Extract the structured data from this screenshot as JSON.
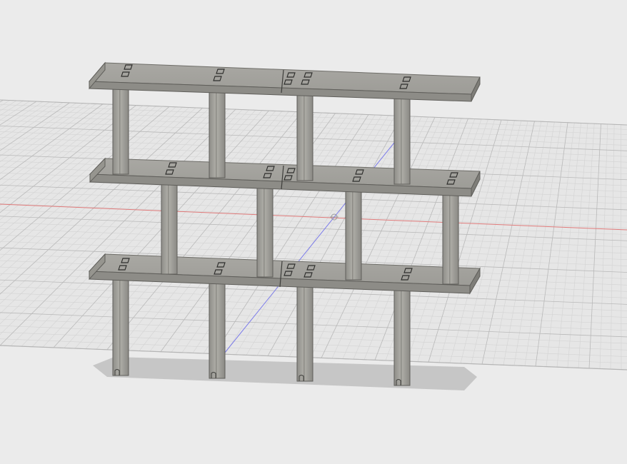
{
  "viewport": {
    "background_color": "#ebebeb",
    "grid": {
      "visible": true,
      "major_color": "#b9b9b9",
      "minor_color": "#d3d3d3"
    },
    "axes": {
      "x_axis_color": "#e07a7a",
      "y_axis_color": "#7b7bea"
    },
    "origin_marker": "origin-icon"
  },
  "model": {
    "type": "shelf-assembly",
    "shelf_count": 3,
    "panel_color": "#a7a59f",
    "shadow_color": "#c6c6c6"
  }
}
